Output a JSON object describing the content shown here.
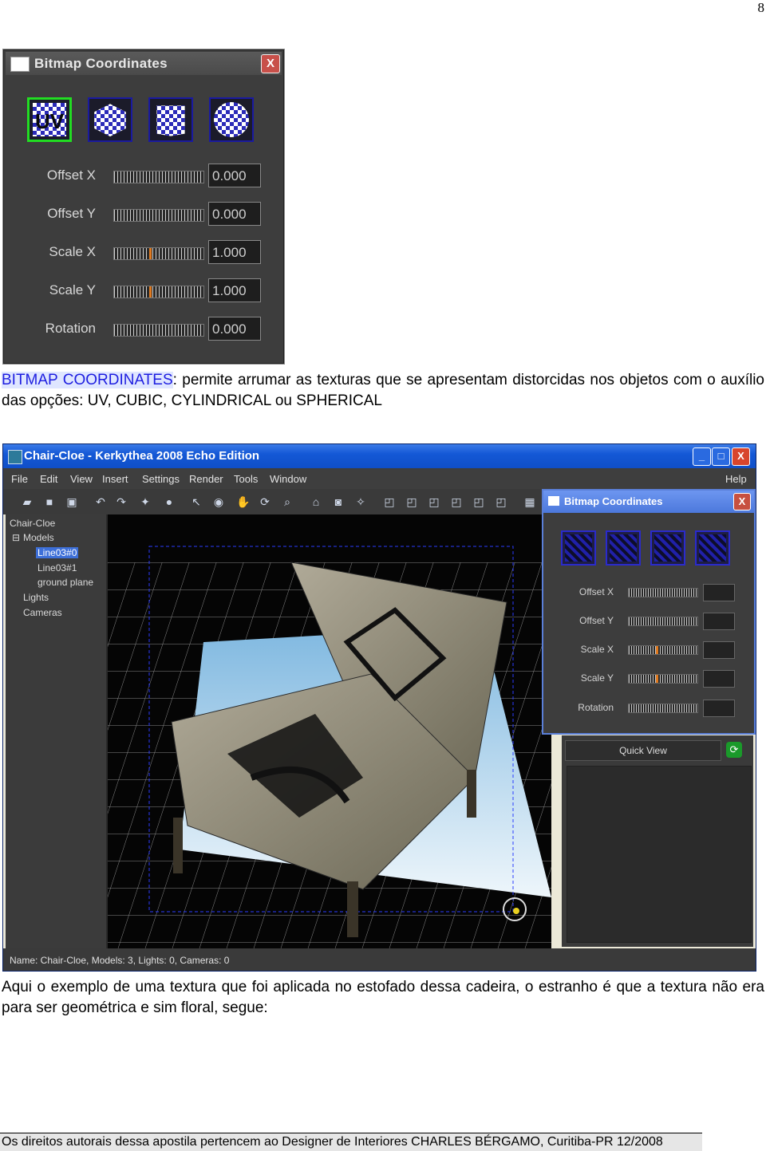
{
  "page_number": "8",
  "top_dialog": {
    "title": "Bitmap Coordinates",
    "close_label": "X",
    "mapping_buttons": [
      {
        "label": "UV",
        "icon": "uv-checker-icon",
        "selected": true
      },
      {
        "label": "",
        "icon": "cube-checker-icon",
        "selected": false
      },
      {
        "label": "",
        "icon": "cylinder-checker-icon",
        "selected": false
      },
      {
        "label": "",
        "icon": "sphere-checker-icon",
        "selected": false
      }
    ],
    "rows": [
      {
        "label": "Offset X",
        "value": "0.000",
        "slider_level": 0.0
      },
      {
        "label": "Offset Y",
        "value": "0.000",
        "slider_level": 0.0
      },
      {
        "label": "Scale X",
        "value": "1.000",
        "slider_level": 0.4
      },
      {
        "label": "Scale Y",
        "value": "1.000",
        "slider_level": 0.4
      },
      {
        "label": "Rotation",
        "value": "0.000",
        "slider_level": 0.0
      }
    ]
  },
  "paragraph1": {
    "highlight": "BITMAP COORDINATES",
    "rest": ": permite arrumar as texturas que se apresentam distorcidas nos objetos com o auxílio das opções: UV, CUBIC, CYLINDRICAL ou SPHERICAL"
  },
  "app": {
    "title": "Chair-Cloe - Kerkythea 2008 Echo Edition",
    "window_buttons": [
      "_",
      "□",
      "X"
    ],
    "menu": [
      "File",
      "Edit",
      "View",
      "Insert",
      "Settings",
      "Render",
      "Tools",
      "Window"
    ],
    "help": "Help",
    "tree": {
      "root": "Chair-Cloe",
      "models_label": "Models",
      "models": [
        "Line03#0",
        "Line03#1",
        "ground plane"
      ],
      "lights": "Lights",
      "cameras": "Cameras"
    },
    "panel": {
      "title": "Bitmap Coordinates",
      "rows": [
        "Offset X",
        "Offset Y",
        "Scale X",
        "Scale Y",
        "Rotation"
      ]
    },
    "quick_view": "Quick View",
    "status": "Name: Chair-Cloe, Models: 3, Lights: 0, Cameras: 0"
  },
  "caption": "Aqui o exemplo de uma textura que foi aplicada no estofado dessa cadeira, o estranho é que a textura não era para ser geométrica e sim floral, segue:",
  "footer": "Os direitos autorais dessa apostila pertencem ao Designer de Interiores CHARLES BÉRGAMO, Curitiba-PR 12/2008",
  "colors": {
    "accent_blue": "#1e1ee0",
    "selected_green": "#22dd22",
    "slider_knob": "#e07a20"
  }
}
